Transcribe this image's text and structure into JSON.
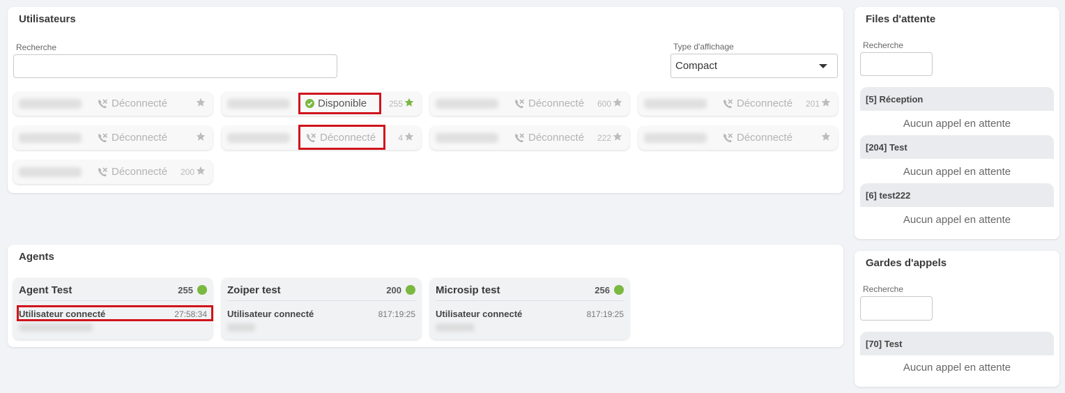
{
  "users_panel": {
    "title": "Utilisateurs",
    "search_label": "Recherche",
    "search_value": "",
    "display_type_label": "Type d'affichage",
    "display_type_value": "Compact",
    "users": [
      {
        "status": "Déconnecté",
        "extension": "",
        "online": false,
        "favorite": false
      },
      {
        "status": "Disponible",
        "extension": "255",
        "online": true,
        "favorite": true
      },
      {
        "status": "Déconnecté",
        "extension": "600",
        "online": false,
        "favorite": false
      },
      {
        "status": "Déconnecté",
        "extension": "201",
        "online": false,
        "favorite": false
      },
      {
        "status": "Déconnecté",
        "extension": "",
        "online": false,
        "favorite": false
      },
      {
        "status": "Déconnecté",
        "extension": "4",
        "online": false,
        "favorite": false
      },
      {
        "status": "Déconnecté",
        "extension": "222",
        "online": false,
        "favorite": false
      },
      {
        "status": "Déconnecté",
        "extension": "",
        "online": false,
        "favorite": false
      },
      {
        "status": "Déconnecté",
        "extension": "200",
        "online": false,
        "favorite": false
      }
    ]
  },
  "agents_panel": {
    "title": "Agents",
    "agents": [
      {
        "name": "Agent Test",
        "extension": "255",
        "status": "Utilisateur connecté",
        "time": "27:58:34"
      },
      {
        "name": "Zoiper test",
        "extension": "200",
        "status": "Utilisateur connecté",
        "time": "817:19:25"
      },
      {
        "name": "Microsip test",
        "extension": "256",
        "status": "Utilisateur connecté",
        "time": "817:19:25"
      }
    ]
  },
  "queues_panel": {
    "title": "Files d'attente",
    "search_label": "Recherche",
    "search_value": "",
    "queues": [
      {
        "name": "[5] Réception",
        "empty_text": "Aucun appel en attente"
      },
      {
        "name": "[204] Test",
        "empty_text": "Aucun appel en attente"
      },
      {
        "name": "[6] test222",
        "empty_text": "Aucun appel en attente"
      }
    ]
  },
  "guards_panel": {
    "title": "Gardes d'appels",
    "search_label": "Recherche",
    "search_value": "",
    "guards": [
      {
        "name": "[70] Test",
        "empty_text": "Aucun appel en attente"
      }
    ]
  },
  "colors": {
    "online_green": "#7ab840",
    "highlight_red": "#d0141b",
    "offline_gray": "#b3b3b3"
  },
  "icons": {
    "offline": "phone-disconnected-icon",
    "online": "check-circle-icon",
    "favorite": "star-icon",
    "dropdown": "caret-down-icon",
    "agent_status": "status-dot-icon"
  }
}
